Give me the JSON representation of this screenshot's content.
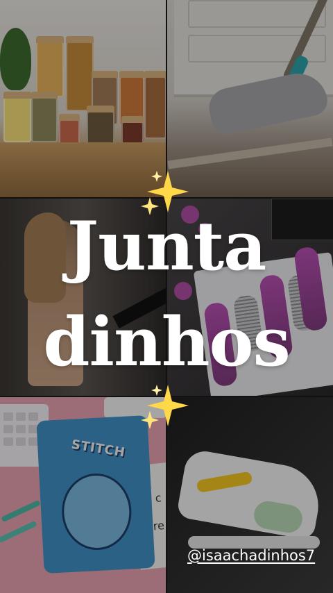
{
  "story": {
    "title_line_1": "Junta",
    "title_line_2": "dinhos",
    "handle": "@isaachadinhos7",
    "stitch_notebook_label": "STITCH",
    "paper_text_1": "nd c",
    "paper_text_2": "alre"
  },
  "tiles": [
    {
      "subject": "pantry-jars"
    },
    {
      "subject": "cleaning-mop"
    },
    {
      "subject": "fitness-woman"
    },
    {
      "subject": "hair-styler-kit"
    },
    {
      "subject": "stitch-notebook"
    },
    {
      "subject": "kids-sneakers"
    }
  ],
  "icons": [
    "sparkles-icon",
    "sparkles-icon"
  ],
  "colors": {
    "title": "#ffffff",
    "sparkle": "#ffd84a",
    "handle": "#ffffff",
    "background": "#111111"
  }
}
